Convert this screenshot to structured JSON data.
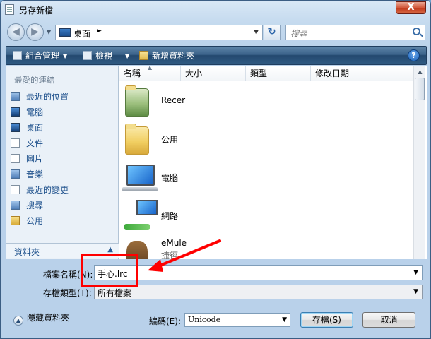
{
  "window": {
    "title": "另存新檔",
    "close_label": "X"
  },
  "address": {
    "location": "桌面",
    "crumb_arrow": "►"
  },
  "search": {
    "placeholder": "搜尋"
  },
  "toolbar": {
    "organize": "組合管理",
    "views": "檢視",
    "new_folder": "新增資料夾",
    "help": "?"
  },
  "nav": {
    "header": "最愛的連結",
    "items": [
      {
        "label": "最近的位置",
        "icon": "recent-places-icon"
      },
      {
        "label": "電腦",
        "icon": "computer-icon"
      },
      {
        "label": "桌面",
        "icon": "desktop-icon"
      },
      {
        "label": "文件",
        "icon": "documents-icon"
      },
      {
        "label": "圖片",
        "icon": "pictures-icon"
      },
      {
        "label": "音樂",
        "icon": "music-icon"
      },
      {
        "label": "最近的變更",
        "icon": "recently-changed-icon"
      },
      {
        "label": "搜尋",
        "icon": "searches-icon"
      },
      {
        "label": "公用",
        "icon": "public-folder-icon"
      }
    ],
    "footer": "資料夾"
  },
  "columns": [
    "名稱",
    "大小",
    "類型",
    "修改日期"
  ],
  "files": [
    {
      "name": "Recer",
      "icon": "folder-icon"
    },
    {
      "name": "公用",
      "icon": "folder-icon"
    },
    {
      "name": "電腦",
      "icon": "computer-icon"
    },
    {
      "name": "網路",
      "icon": "network-icon"
    },
    {
      "name": "eMule",
      "sub": "捷徑",
      "icon": "emule-icon"
    }
  ],
  "form": {
    "filename_label": "檔案名稱(N):",
    "filename_value": "手心.lrc",
    "filetype_label": "存檔類型(T):",
    "filetype_value": "所有檔案",
    "hide_folders": "隱藏資料夾",
    "encoding_label": "編碼(E):",
    "encoding_value": "Unicode",
    "save": "存檔(S)",
    "cancel": "取消"
  },
  "colors": {
    "annotation": "#ff0000",
    "toolbar": "#2f5a82",
    "link": "#1c4f8b"
  }
}
